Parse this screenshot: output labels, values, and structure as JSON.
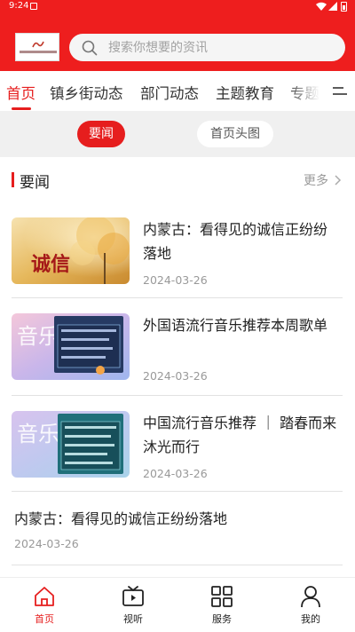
{
  "status_bar": {
    "time": "9:24"
  },
  "header": {
    "search_placeholder": "搜索你想要的资讯"
  },
  "tabs": [
    {
      "label": "首页",
      "active": true
    },
    {
      "label": "镇乡街动态",
      "active": false
    },
    {
      "label": "部门动态",
      "active": false
    },
    {
      "label": "主题教育",
      "active": false
    },
    {
      "label": "专题",
      "active": false
    }
  ],
  "sub_tabs": [
    {
      "label": "要闻",
      "active": true
    },
    {
      "label": "首页头图",
      "active": false
    }
  ],
  "section": {
    "title": "要闻",
    "more_label": "更多"
  },
  "news": [
    {
      "title": "内蒙古：看得见的诚信正纷纷落地",
      "date": "2024-03-26",
      "thumb_text": "诚信"
    },
    {
      "title": "外国语流行音乐推荐本周歌单",
      "date": "2024-03-26",
      "thumb_text": "音乐"
    },
    {
      "title": "中国流行音乐推荐 ｜ 踏春而来 沐光而行",
      "date": "2024-03-26",
      "thumb_text": "音乐"
    }
  ],
  "text_news": [
    {
      "title": "内蒙古：看得见的诚信正纷纷落地",
      "date": "2024-03-26"
    }
  ],
  "bottom_nav": [
    {
      "label": "首页",
      "active": true
    },
    {
      "label": "视听",
      "active": false
    },
    {
      "label": "服务",
      "active": false
    },
    {
      "label": "我的",
      "active": false
    }
  ],
  "colors": {
    "brand": "#ee1e1e",
    "accent": "#e61e1e"
  }
}
